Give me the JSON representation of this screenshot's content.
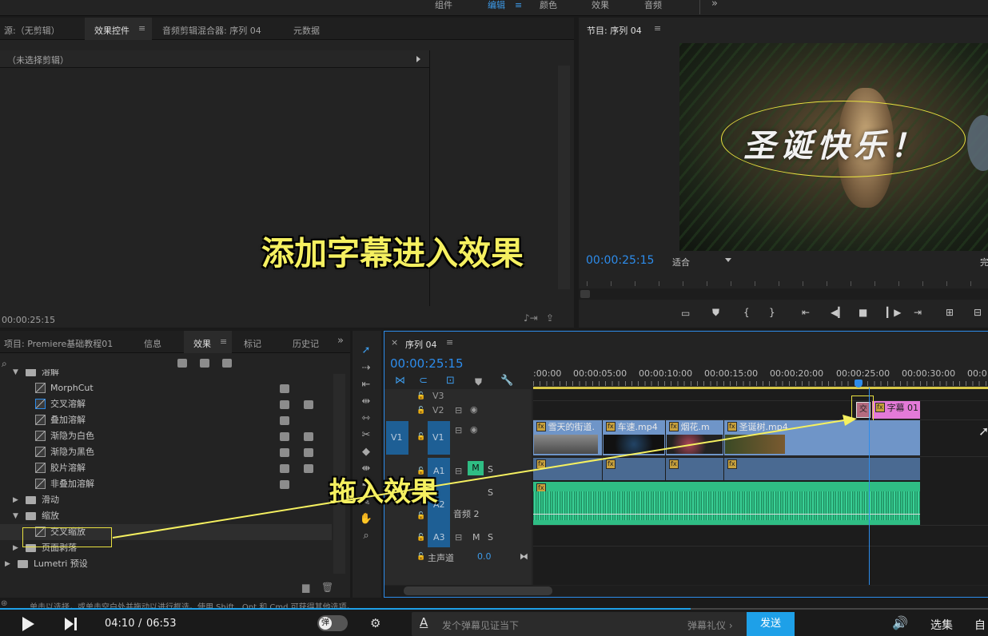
{
  "workspace_tabs": [
    "组件",
    "编辑",
    "颜色",
    "效果",
    "音频"
  ],
  "workspace_more": "»",
  "source_panel": {
    "tabs": [
      "源:（无剪辑）",
      "效果控件",
      "音频剪辑混合器: 序列 04",
      "元数据"
    ],
    "no_clip": "（未选择剪辑）",
    "timecode": "00:00:25:15"
  },
  "program_panel": {
    "title": "节目: 序列 04",
    "timecode": "00:00:25:15",
    "fit": "适合",
    "full": "完",
    "video_title_text": "圣诞快乐！"
  },
  "project_panel": {
    "tabs": [
      "项目: Premiere基础教程01",
      "信息",
      "效果",
      "标记",
      "历史记"
    ],
    "more": "»",
    "tree": [
      {
        "type": "folder",
        "label": "溶解",
        "open": true,
        "indent": 0
      },
      {
        "type": "effect",
        "label": "MorphCut",
        "indent": 1
      },
      {
        "type": "effect",
        "label": "交叉溶解",
        "indent": 1
      },
      {
        "type": "effect",
        "label": "叠加溶解",
        "indent": 1
      },
      {
        "type": "effect",
        "label": "渐隐为白色",
        "indent": 1
      },
      {
        "type": "effect",
        "label": "渐隐为黑色",
        "indent": 1
      },
      {
        "type": "effect",
        "label": "胶片溶解",
        "indent": 1
      },
      {
        "type": "effect",
        "label": "非叠加溶解",
        "indent": 1
      },
      {
        "type": "folder",
        "label": "滑动",
        "open": false,
        "indent": 0
      },
      {
        "type": "folder",
        "label": "缩放",
        "open": true,
        "indent": 0
      },
      {
        "type": "effect",
        "label": "交叉缩放",
        "indent": 1
      },
      {
        "type": "folder",
        "label": "页面剥落",
        "open": false,
        "indent": 0
      },
      {
        "type": "folder",
        "label": "Lumetri 预设",
        "open": false,
        "indent": -1
      }
    ]
  },
  "timeline": {
    "tab": "序列 04",
    "timecode": "00:00:25:15",
    "ruler": [
      ":00:00",
      "00:00:05:00",
      "00:00:10:00",
      "00:00:15:00",
      "00:00:20:00",
      "00:00:25:00",
      "00:00:30:00",
      "00:0"
    ],
    "tracks": {
      "v3": "V3",
      "v2": "V2",
      "v1": "V1",
      "v1src": "V1",
      "a1": "A1",
      "a2": "A2",
      "a3": "A3",
      "a1src": "A1",
      "a2_name": "音频 2",
      "m": "M",
      "s": "S",
      "master": "主声道",
      "master_val": "0.0"
    },
    "clips": {
      "c1": "雪天的街道.",
      "c2": "车速.mp4",
      "c3": "烟花.m",
      "c4": "圣诞树.mp4",
      "title": "字幕 01",
      "trans": "交",
      "fx": "fx"
    }
  },
  "status_text": "单击以选择，或单击空白处并拖动以进行框选。使用 Shift、Opt 和 Cmd 可获得其他选项。",
  "annotations": {
    "main": "添加字幕进入效果",
    "drag": "拖入效果"
  },
  "player": {
    "time_current": "04:10",
    "time_sep": "/",
    "time_total": "06:53",
    "danmu_toggle": "弹",
    "danmu_placeholder": "发个弹幕见证当下",
    "danmu_etiquette": "弹幕礼仪 ›",
    "send": "发送",
    "episodes": "选集",
    "auto": "自"
  },
  "colors": {
    "accent": "#2d8ceb",
    "annotation": "#f5f060",
    "video_clip": "#6f95c8",
    "audio_clip": "#2fbd84",
    "title_clip": "#e47ad8",
    "send": "#1ea0e8"
  }
}
